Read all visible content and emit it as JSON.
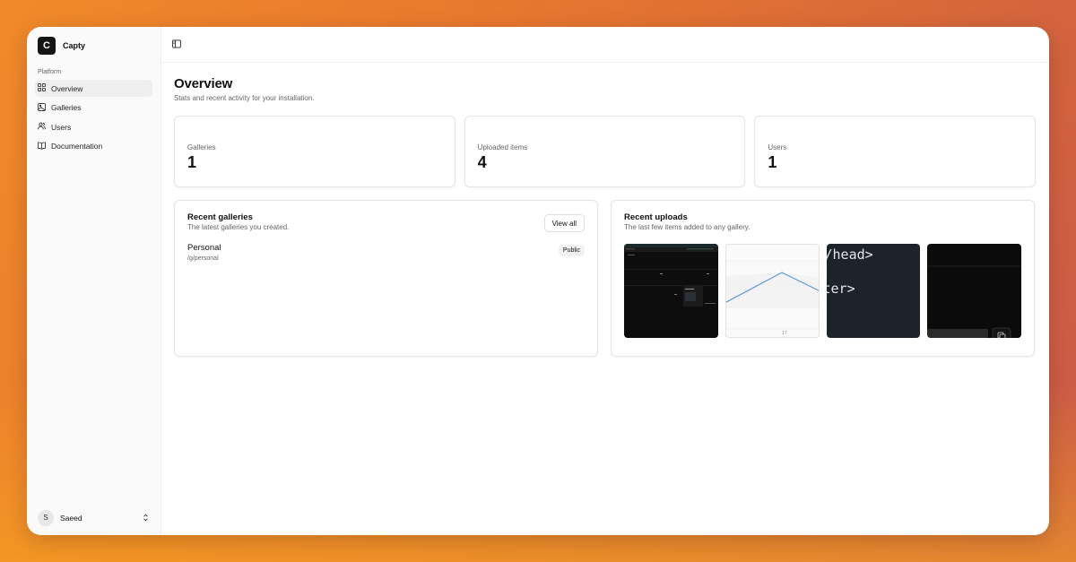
{
  "brand": {
    "logo_letter": "C",
    "name": "Capty"
  },
  "sidebar": {
    "section_label": "Platform",
    "items": [
      {
        "label": "Overview",
        "icon": "grid-icon",
        "active": true
      },
      {
        "label": "Galleries",
        "icon": "image-icon",
        "active": false
      },
      {
        "label": "Users",
        "icon": "users-icon",
        "active": false
      },
      {
        "label": "Documentation",
        "icon": "book-icon",
        "active": false
      }
    ],
    "user": {
      "initial": "S",
      "name": "Saeed"
    }
  },
  "header": {
    "toggle_icon": "sidebar-toggle-icon"
  },
  "page": {
    "title": "Overview",
    "subtitle": "Stats and recent activity for your installation."
  },
  "stats": [
    {
      "label": "Galleries",
      "value": "1"
    },
    {
      "label": "Uploaded items",
      "value": "4"
    },
    {
      "label": "Users",
      "value": "1"
    }
  ],
  "recent_galleries": {
    "title": "Recent galleries",
    "subtitle": "The latest galleries you created.",
    "view_all_label": "View all",
    "items": [
      {
        "name": "Personal",
        "path": "/g/personal",
        "badge": "Public"
      }
    ]
  },
  "recent_uploads": {
    "title": "Recent uploads",
    "subtitle": "The last few items added to any gallery.",
    "thumbnail_2_label": "17",
    "thumbnail_3_lines": [
      "/head>",
      "ter>"
    ]
  },
  "colors": {
    "accent_line": "#4a90d9",
    "sidebar_bg": "#fafafa",
    "background_gradient_start": "#f08a2a",
    "background_gradient_end": "#c9584a"
  }
}
